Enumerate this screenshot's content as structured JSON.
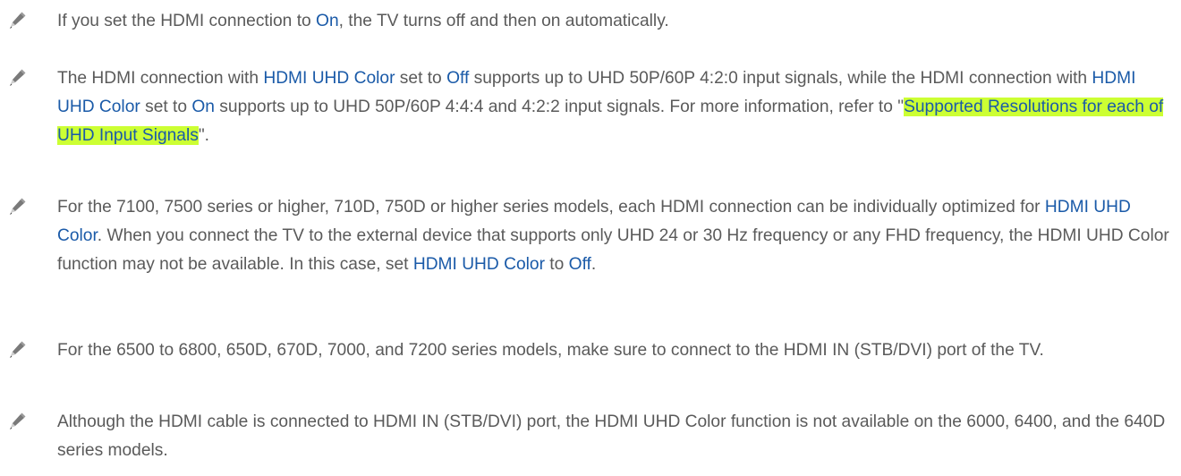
{
  "notes": [
    {
      "icon": "pencil-icon",
      "segments": [
        {
          "t": "If you set the HDMI connection to ",
          "s": "plain"
        },
        {
          "t": "On",
          "s": "kw"
        },
        {
          "t": ", the TV turns off and then on automatically.",
          "s": "plain"
        }
      ]
    },
    {
      "icon": "pencil-icon",
      "segments": [
        {
          "t": "The HDMI connection with ",
          "s": "plain"
        },
        {
          "t": "HDMI UHD Color",
          "s": "kw"
        },
        {
          "t": " set to ",
          "s": "plain"
        },
        {
          "t": "Off",
          "s": "kw"
        },
        {
          "t": " supports up to UHD 50P/60P 4:2:0 input signals, while the HDMI connection with ",
          "s": "plain"
        },
        {
          "t": "HDMI UHD Color",
          "s": "kw"
        },
        {
          "t": " set to ",
          "s": "plain"
        },
        {
          "t": "On",
          "s": "kw"
        },
        {
          "t": " supports up to UHD 50P/60P 4:4:4 and 4:2:2 input signals. For more information, refer to \"",
          "s": "plain"
        },
        {
          "t": "Supported Resolutions for each of UHD Input Signals",
          "s": "hl"
        },
        {
          "t": "\".",
          "s": "plain"
        }
      ]
    },
    {
      "icon": "pencil-icon",
      "segments": [
        {
          "t": "For the 7100, 7500 series or higher, 710D, 750D or higher series models, each HDMI connection can be individually optimized for ",
          "s": "plain"
        },
        {
          "t": "HDMI UHD Color",
          "s": "kw"
        },
        {
          "t": ". When you connect the TV to the external device that supports only UHD 24 or 30 Hz frequency or any FHD frequency, the HDMI UHD Color function may not be available. In this case, set ",
          "s": "plain"
        },
        {
          "t": "HDMI UHD Color",
          "s": "kw"
        },
        {
          "t": " to ",
          "s": "plain"
        },
        {
          "t": "Off",
          "s": "kw"
        },
        {
          "t": ".",
          "s": "plain"
        }
      ]
    },
    {
      "icon": "pencil-icon",
      "segments": [
        {
          "t": "For the 6500 to 6800, 650D, 670D, 7000, and 7200 series models, make sure to connect to the HDMI IN (STB/DVI) port of the TV.",
          "s": "plain"
        }
      ]
    },
    {
      "icon": "pencil-icon",
      "segments": [
        {
          "t": "Although the HDMI cable is connected to HDMI IN (STB/DVI) port, the HDMI UHD Color function is not available on the 6000, 6400, and the 640D series models.",
          "s": "plain"
        }
      ]
    }
  ]
}
